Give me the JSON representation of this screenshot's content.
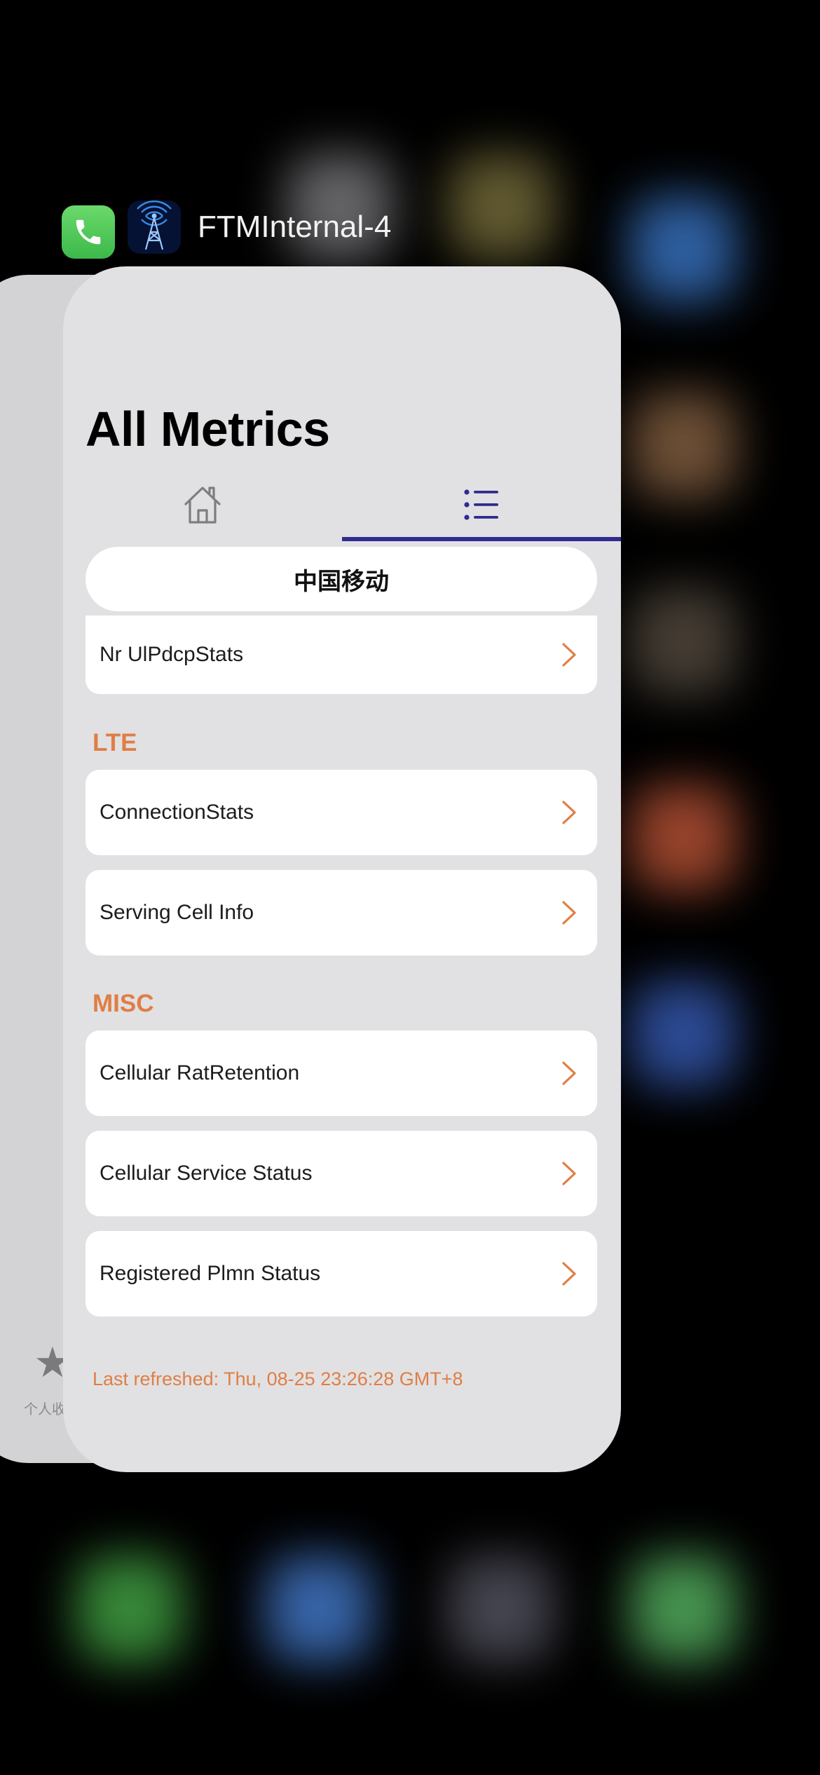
{
  "switcher": {
    "app_title": "FTMInternal-4"
  },
  "back_card": {
    "favorites_label": "个人收"
  },
  "page": {
    "title": "All Metrics"
  },
  "tabs": [
    {
      "name": "home",
      "icon": "house-icon",
      "selected": false
    },
    {
      "name": "list",
      "icon": "list-icon",
      "selected": true
    }
  ],
  "carrier": {
    "label": "中国移动"
  },
  "nr_section": {
    "items": [
      {
        "label": "Nr UlPdcpStats"
      }
    ]
  },
  "lte_section": {
    "header": "LTE",
    "items": [
      {
        "label": "ConnectionStats"
      },
      {
        "label": "Serving Cell Info"
      }
    ]
  },
  "misc_section": {
    "header": "MISC",
    "items": [
      {
        "label": "Cellular RatRetention"
      },
      {
        "label": "Cellular Service Status"
      },
      {
        "label": "Registered Plmn Status"
      }
    ]
  },
  "footer": {
    "last_refreshed": "Last refreshed: Thu, 08-25 23:26:28 GMT+8"
  },
  "colors": {
    "accent_orange": "#e07e45",
    "tab_indicator": "#2f2b8f",
    "card_background": "#e1e1e3"
  }
}
